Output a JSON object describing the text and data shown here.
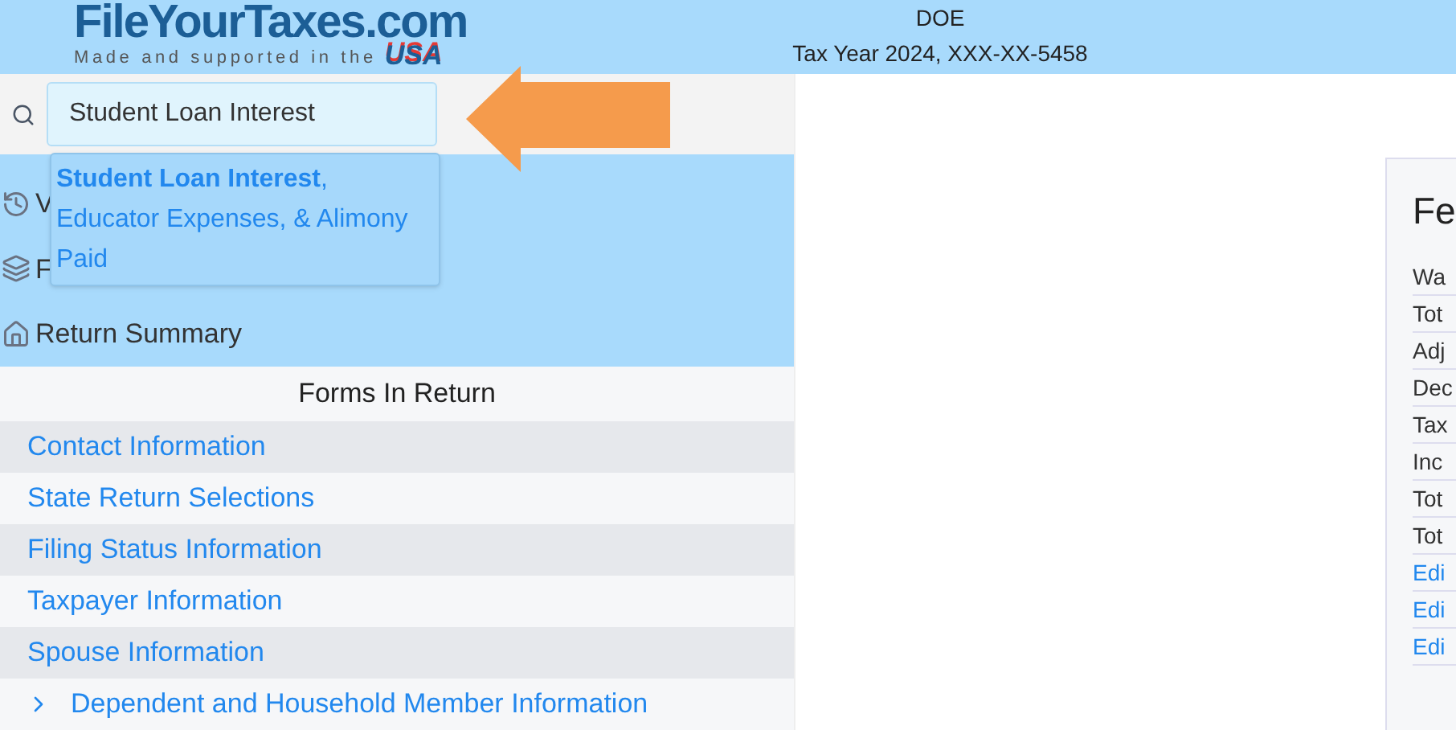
{
  "header": {
    "logo": {
      "name": "FileYourTaxes.com",
      "tagline": "Made and supported in the",
      "country": "USA"
    },
    "taxpayer": "DOE",
    "tax_year": "Tax Year 2024, XXX-XX-5458"
  },
  "search": {
    "value": "Student Loan Interest",
    "suggestion": "**Student Loan Interest**, Educator Expenses, & Alimony Paid"
  },
  "nav": [
    {
      "kind": "history",
      "label": "V"
    },
    {
      "kind": "layers",
      "label": "F"
    },
    {
      "kind": "home",
      "label": "Return Summary"
    }
  ],
  "forms": {
    "title": "Forms In Return",
    "items": [
      {
        "label": "Contact Information",
        "expandable": false
      },
      {
        "label": "State Return Selections",
        "expandable": false
      },
      {
        "label": "Filing Status Information",
        "expandable": false
      },
      {
        "label": "Taxpayer Information",
        "expandable": false
      },
      {
        "label": "Spouse Information",
        "expandable": false
      },
      {
        "label": "Dependent and Household Member Information",
        "expandable": true
      }
    ]
  },
  "summary_card": {
    "title": "Fe",
    "rows": [
      {
        "label": "Wa",
        "kind": "text"
      },
      {
        "label": "Tot",
        "kind": "text"
      },
      {
        "label": "Adj",
        "kind": "text"
      },
      {
        "label": "Dec",
        "kind": "text"
      },
      {
        "label": "Tax",
        "kind": "text"
      },
      {
        "label": "Inc",
        "kind": "text"
      },
      {
        "label": "Tot",
        "kind": "text"
      },
      {
        "label": "Tot",
        "kind": "text"
      },
      {
        "label": "Edi",
        "kind": "link"
      },
      {
        "label": "Edi",
        "kind": "link"
      },
      {
        "label": "Edi",
        "kind": "link"
      }
    ]
  }
}
